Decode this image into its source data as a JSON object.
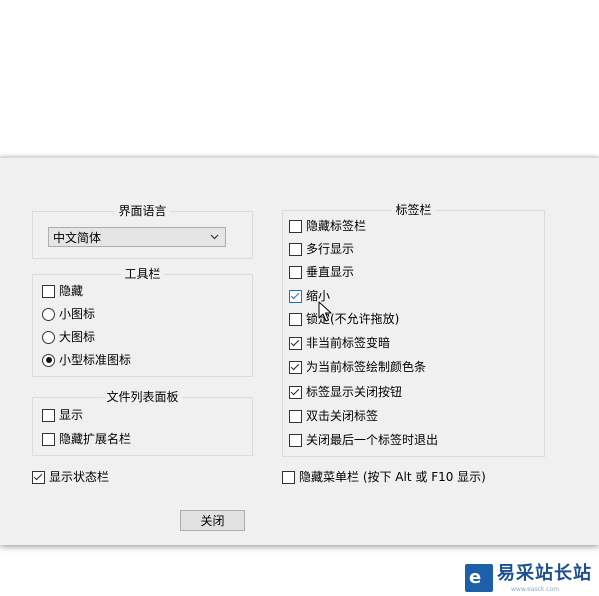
{
  "language_group": {
    "title": "界面语言",
    "selected": "中文简体"
  },
  "toolbar_group": {
    "title": "工具栏",
    "hide_label": "隐藏",
    "small_icons_label": "小图标",
    "large_icons_label": "大图标",
    "small_standard_icons_label": "小型标准图标",
    "selected": "小型标准图标"
  },
  "file_list_group": {
    "title": "文件列表面板",
    "show_label": "显示",
    "hide_ext_label": "隐藏扩展名栏"
  },
  "show_status_bar": {
    "label": "显示状态栏",
    "checked": true
  },
  "tab_group": {
    "title": "标签栏",
    "items": [
      {
        "label": "隐藏标签栏",
        "checked": false
      },
      {
        "label": "多行显示",
        "checked": false
      },
      {
        "label": "垂直显示",
        "checked": false
      },
      {
        "label": "缩小",
        "checked": true
      },
      {
        "label": "锁定(不允许拖放)",
        "checked": false
      },
      {
        "label": "非当前标签变暗",
        "checked": true
      },
      {
        "label": "为当前标签绘制颜色条",
        "checked": true
      },
      {
        "label": "标签显示关闭按钮",
        "checked": true
      },
      {
        "label": "双击关闭标签",
        "checked": false
      },
      {
        "label": "关闭最后一个标签时退出",
        "checked": false
      }
    ]
  },
  "hide_menu_bar": {
    "label": "隐藏菜单栏 (按下 Alt 或 F10 显示)",
    "checked": false
  },
  "close_button": {
    "label": "关闭"
  },
  "watermark": {
    "logo_glyph": "e",
    "text": "易采站长站",
    "subtext": "www.easck.com"
  },
  "colors": {
    "dialog_bg": "#f0f0f0",
    "accent": "#1e70c9",
    "watermark": "#1d5fa8"
  }
}
